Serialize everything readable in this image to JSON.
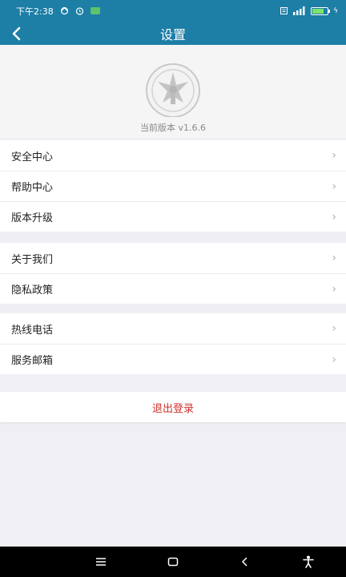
{
  "status_bar": {
    "time": "下午2:38",
    "icons": [
      "sync-icon",
      "alarm-icon",
      "app-notification-icon",
      "sim-icon",
      "signal-icon",
      "battery-icon"
    ]
  },
  "title_bar": {
    "title": "设置",
    "back_icon": "chevron-left-icon"
  },
  "header": {
    "logo": "emblem-logo",
    "version_text": "当前版本  v1.6.6"
  },
  "menu_groups": [
    {
      "items": [
        {
          "label": "安全中心"
        },
        {
          "label": "帮助中心"
        },
        {
          "label": "版本升级"
        }
      ]
    },
    {
      "items": [
        {
          "label": "关于我们"
        },
        {
          "label": "隐私政策"
        }
      ]
    },
    {
      "items": [
        {
          "label": "热线电话"
        },
        {
          "label": "服务邮箱"
        }
      ]
    }
  ],
  "logout_label": "退出登录",
  "nav_bar": {
    "buttons": [
      "menu-icon",
      "home-icon",
      "back-icon",
      "accessibility-icon"
    ]
  },
  "colors": {
    "primary": "#1d7ea6",
    "logout": "#d0312d",
    "background": "#efeff4"
  }
}
